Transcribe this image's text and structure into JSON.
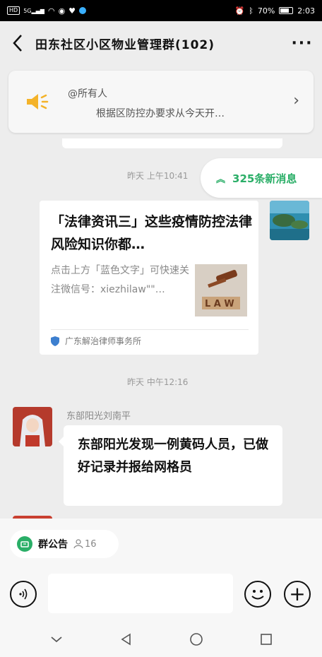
{
  "status_bar": {
    "network_badge": "HD",
    "signal_badge": "5G",
    "battery_percent": "70%",
    "time": "2:03"
  },
  "header": {
    "title": "田东社区小区物业管理群(102)",
    "back_icon": "chevron-left-icon",
    "more_icon": "more-dots-icon"
  },
  "pinned_notice": {
    "mention": "@所有人",
    "text": "根据区防控办要求从今天开…",
    "icon": "speaker-icon"
  },
  "new_messages": {
    "label": "325条新消息",
    "color": "#2aae67"
  },
  "messages": [
    {
      "timestamp": "昨天 上午10:41",
      "type": "link-card",
      "card_title": "「法律资讯三」这些疫情防控法律风险知识你都…",
      "card_desc": "点击上方「蓝色文字」可快速关注微信号：xiezhilaw\"\"…",
      "source": "广东解治律师事务所"
    },
    {
      "timestamp": "昨天 中午12:16",
      "sender": "东部阳光刘南平",
      "text": "东部阳光发现一例黄码人员，已做好记录并报给网格员"
    }
  ],
  "bottom_bar": {
    "announcement_label": "群公告",
    "member_count": "16",
    "input_placeholder": ""
  }
}
